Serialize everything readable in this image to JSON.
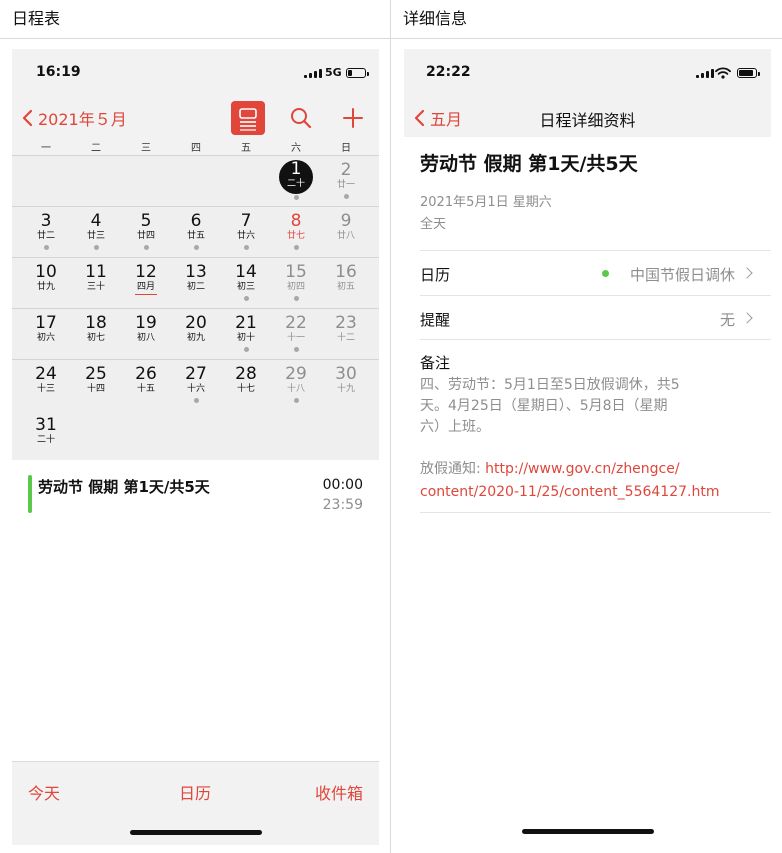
{
  "left_title": "日程表",
  "right_title": "详细信息",
  "left_phone": {
    "status": {
      "time": "16:19",
      "network": "5G"
    },
    "nav": {
      "back_label": "2021年５月"
    },
    "weekdays": [
      "一",
      "二",
      "三",
      "四",
      "五",
      "六",
      "日"
    ],
    "weeks": [
      [
        null,
        null,
        null,
        null,
        null,
        {
          "d": "1",
          "l": "二十",
          "dot": true,
          "selected": true
        },
        {
          "d": "2",
          "l": "廿一",
          "dot": true,
          "weekend": true
        }
      ],
      [
        {
          "d": "3",
          "l": "廿二",
          "dot": true
        },
        {
          "d": "4",
          "l": "廿三",
          "dot": true
        },
        {
          "d": "5",
          "l": "廿四",
          "dot": true
        },
        {
          "d": "6",
          "l": "廿五",
          "dot": true
        },
        {
          "d": "7",
          "l": "廿六",
          "dot": true
        },
        {
          "d": "8",
          "l": "廿七",
          "dot": true,
          "holiday": true
        },
        {
          "d": "9",
          "l": "廿八",
          "weekend": true
        }
      ],
      [
        {
          "d": "10",
          "l": "廿九"
        },
        {
          "d": "11",
          "l": "三十"
        },
        {
          "d": "12",
          "l": "四月",
          "underline": true
        },
        {
          "d": "13",
          "l": "初二"
        },
        {
          "d": "14",
          "l": "初三",
          "dot": true
        },
        {
          "d": "15",
          "l": "初四",
          "dot": true,
          "weekend": true
        },
        {
          "d": "16",
          "l": "初五",
          "weekend": true
        }
      ],
      [
        {
          "d": "17",
          "l": "初六"
        },
        {
          "d": "18",
          "l": "初七"
        },
        {
          "d": "19",
          "l": "初八"
        },
        {
          "d": "20",
          "l": "初九"
        },
        {
          "d": "21",
          "l": "初十",
          "dot": true
        },
        {
          "d": "22",
          "l": "十一",
          "dot": true,
          "weekend": true
        },
        {
          "d": "23",
          "l": "十二",
          "weekend": true
        }
      ],
      [
        {
          "d": "24",
          "l": "十三"
        },
        {
          "d": "25",
          "l": "十四"
        },
        {
          "d": "26",
          "l": "十五"
        },
        {
          "d": "27",
          "l": "十六",
          "dot": true
        },
        {
          "d": "28",
          "l": "十七"
        },
        {
          "d": "29",
          "l": "十八",
          "dot": true,
          "weekend": true
        },
        {
          "d": "30",
          "l": "十九",
          "weekend": true
        }
      ],
      [
        {
          "d": "31",
          "l": "二十"
        },
        null,
        null,
        null,
        null,
        null,
        null
      ]
    ],
    "event": {
      "title": "劳动节 假期 第1天/共5天",
      "start": "00:00",
      "end": "23:59",
      "color": "#5ac84a"
    },
    "tabs": {
      "today": "今天",
      "calendars": "日历",
      "inbox": "收件箱"
    }
  },
  "right_phone": {
    "status": {
      "time": "22:22"
    },
    "nav": {
      "back_label": "五月",
      "title": "日程详细资料"
    },
    "event": {
      "title": "劳动节 假期 第1天/共5天",
      "date": "2021年5月1日 星期六",
      "allday": "全天"
    },
    "calendar_row": {
      "label": "日历",
      "value": "中国节假日调休",
      "dot_color": "#5ac84a"
    },
    "alert_row": {
      "label": "提醒",
      "value": "无"
    },
    "notes": {
      "label": "备注",
      "lines": [
        "四、劳动节：5月1日至5日放假调休，共5",
        "天。4月25日（星期日）、5月8日（星期",
        "六）上班。"
      ],
      "link_prefix": "放假通知: ",
      "link_lines": [
        "http://www.gov.cn/zhengce/",
        "content/2020-11/25/content_5564127.htm"
      ]
    }
  },
  "colors": {
    "accent": "#e0463a",
    "event_green": "#5ac84a"
  }
}
